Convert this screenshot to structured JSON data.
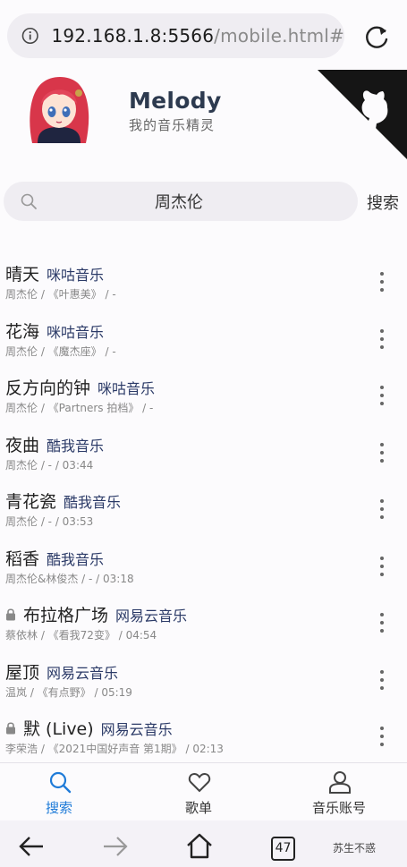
{
  "browser": {
    "url_host": "192.168.1.8:5566",
    "url_path": "/mobile.html#",
    "tab_count": "47"
  },
  "header": {
    "title": "Melody",
    "subtitle": "我的音乐精灵"
  },
  "search": {
    "query": "周杰伦",
    "button_label": "搜索"
  },
  "songs": [
    {
      "name": "晴天",
      "source": "咪咕音乐",
      "meta": "周杰伦 / 《叶惠美》 / -",
      "locked": false
    },
    {
      "name": "花海",
      "source": "咪咕音乐",
      "meta": "周杰伦 / 《魔杰座》 / -",
      "locked": false
    },
    {
      "name": "反方向的钟",
      "source": "咪咕音乐",
      "meta": "周杰伦 / 《Partners 拍档》 / -",
      "locked": false
    },
    {
      "name": "夜曲",
      "source": "酷我音乐",
      "meta": "周杰伦 / - / 03:44",
      "locked": false
    },
    {
      "name": "青花瓷",
      "source": "酷我音乐",
      "meta": "周杰伦 / - / 03:53",
      "locked": false
    },
    {
      "name": "稻香",
      "source": "酷我音乐",
      "meta": "周杰伦&林俊杰 / - / 03:18",
      "locked": false
    },
    {
      "name": "布拉格广场",
      "source": "网易云音乐",
      "meta": "蔡依林 / 《看我72变》 / 04:54",
      "locked": true
    },
    {
      "name": "屋顶",
      "source": "网易云音乐",
      "meta": "温岚 / 《有点野》 / 05:19",
      "locked": false
    },
    {
      "name": "默 (Live)",
      "source": "网易云音乐",
      "meta": "李荣浩 / 《2021中国好声音 第1期》 / 02:13",
      "locked": true
    }
  ],
  "tabbar": {
    "search_label": "搜索",
    "playlist_label": "歌单",
    "account_label": "音乐账号"
  },
  "watermark": "苏生不惑",
  "colors": {
    "accent": "#1f7bd8",
    "source_text": "#2b3a67",
    "corner": "#151515"
  }
}
